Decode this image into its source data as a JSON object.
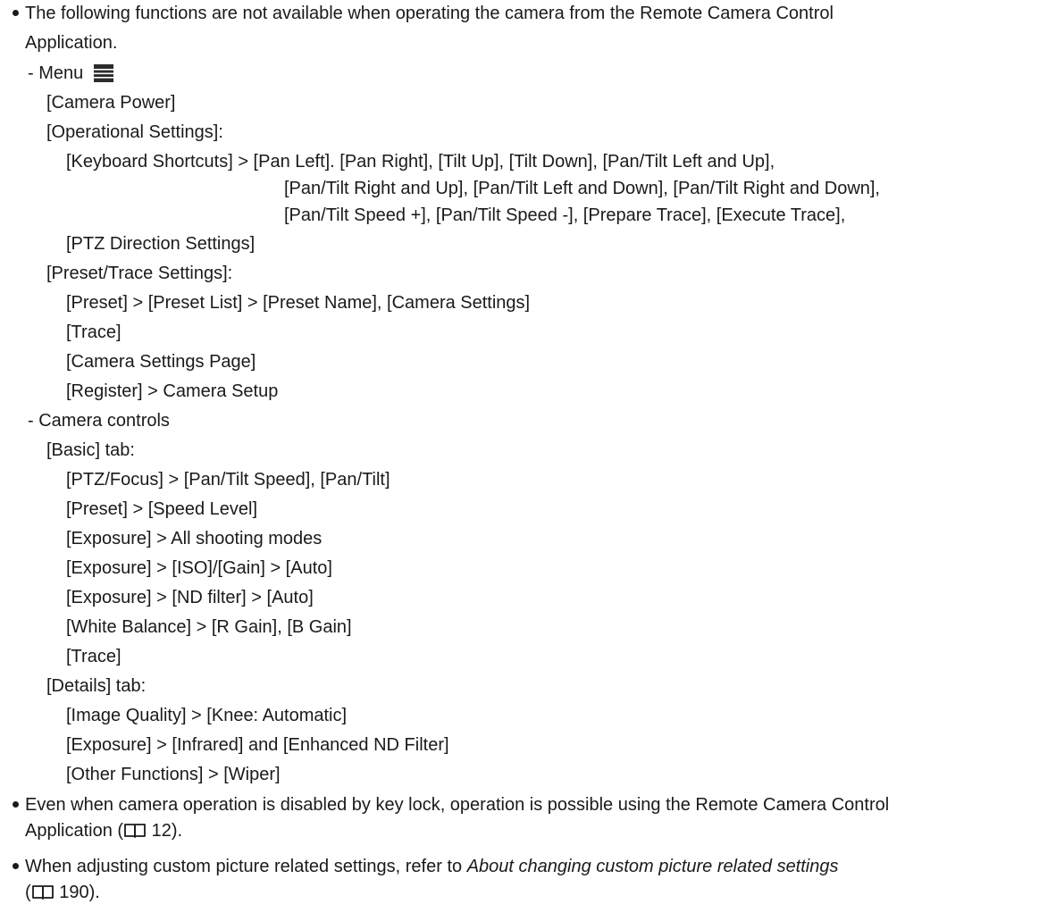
{
  "bullet1": {
    "text_line1": "The following functions are not available when operating the camera from the Remote Camera Control",
    "text_line2": "Application.",
    "menu_label": "- Menu",
    "menu_items": {
      "camera_power": "[Camera Power]",
      "operational_settings": "[Operational Settings]:",
      "keyboard_shortcuts_1": "[Keyboard Shortcuts] > [Pan Left]. [Pan Right], [Tilt Up], [Tilt Down], [Pan/Tilt Left and Up],",
      "keyboard_shortcuts_2": "[Pan/Tilt Right and Up], [Pan/Tilt Left and Down], [Pan/Tilt Right and Down],",
      "keyboard_shortcuts_3": "[Pan/Tilt Speed +], [Pan/Tilt Speed -], [Prepare Trace], [Execute Trace],",
      "ptz_direction": "[PTZ Direction Settings]",
      "preset_trace_settings": "[Preset/Trace Settings]:",
      "preset_list": "[Preset] > [Preset List] > [Preset Name], [Camera Settings]",
      "trace": "[Trace]",
      "camera_settings_page": "[Camera Settings Page]",
      "register": "[Register] > Camera Setup"
    },
    "camera_controls_label": "- Camera controls",
    "basic_tab": {
      "label": "[Basic] tab:",
      "items": [
        "[PTZ/Focus] > [Pan/Tilt Speed], [Pan/Tilt]",
        "[Preset] > [Speed Level]",
        "[Exposure] > All shooting modes",
        "[Exposure] > [ISO]/[Gain] > [Auto]",
        "[Exposure] > [ND filter] > [Auto]",
        "[White Balance] > [R Gain], [B Gain]",
        "[Trace]"
      ]
    },
    "details_tab": {
      "label": "[Details] tab:",
      "items": [
        "[Image Quality] > [Knee: Automatic]",
        "[Exposure] > [Infrared] and [Enhanced ND Filter]",
        "[Other Functions] > [Wiper]"
      ]
    }
  },
  "bullet2": {
    "line1": "Even when camera operation is disabled by key lock, operation is possible using the Remote Camera Control",
    "line2_prefix": "Application (",
    "line2_page": "12",
    "line2_suffix": ")."
  },
  "bullet3": {
    "line1_prefix": "When adjusting custom picture related settings, refer to ",
    "line1_italic": "About changing custom picture related settings",
    "line2_prefix": "(",
    "line2_page": "190",
    "line2_suffix": ")."
  },
  "icons": {
    "menu": "menu-icon",
    "page_reference": "book-icon"
  }
}
